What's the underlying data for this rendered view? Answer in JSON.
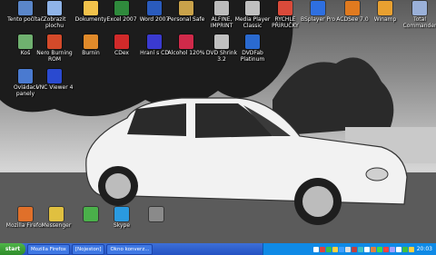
{
  "desktop_icons": [
    {
      "name": "tento-pocitac",
      "label": "Tento počítač",
      "color": "#5a86c9"
    },
    {
      "name": "zobrazit-plochu",
      "label": "Zobrazit plochu",
      "color": "#8fb4e8"
    },
    {
      "name": "dokumenty",
      "label": "Dokumenty",
      "color": "#f2c24b"
    },
    {
      "name": "excel-2007",
      "label": "Excel 2007",
      "color": "#2f8a3c"
    },
    {
      "name": "word-2007",
      "label": "Word 2007",
      "color": "#2a5bbd"
    },
    {
      "name": "personal-safe",
      "label": "Personal Safe",
      "color": "#c9a24a"
    },
    {
      "name": "alfine-imprint",
      "label": "ALFINE, IMPRINT",
      "color": "#bcbcbc"
    },
    {
      "name": "media-player-classic",
      "label": "Media Player Classic",
      "color": "#bfbfbf"
    },
    {
      "name": "rychle-prirucky",
      "label": "RYCHLE PŘÍRUČKY",
      "color": "#d94a3a"
    },
    {
      "name": "bsplayer-pro",
      "label": "BSplayer Pro",
      "color": "#2e6fe0"
    },
    {
      "name": "acdsee",
      "label": "ACDSee 7.0",
      "color": "#e07a1f"
    },
    {
      "name": "winamp",
      "label": "Winamp",
      "color": "#e8a030"
    },
    {
      "name": "total-commander",
      "label": "Total Commander",
      "color": "#9ab0d8"
    },
    {
      "name": "kos",
      "label": "Koš",
      "color": "#6fb06f"
    },
    {
      "name": "nero-burning-rom",
      "label": "Nero Burning ROM",
      "color": "#d44a2a"
    },
    {
      "name": "burnin",
      "label": "Burnin",
      "color": "#e08a2a"
    },
    {
      "name": "cdex",
      "label": "CDex",
      "color": "#d02a2a"
    },
    {
      "name": "hrani-s-cd",
      "label": "Hraní s CD",
      "color": "#3a3ad0"
    },
    {
      "name": "alcohol-120",
      "label": "Alcohol 120%",
      "color": "#d02a4a"
    },
    {
      "name": "dvd-shrink",
      "label": "DVD Shrink 3.2",
      "color": "#c0c0c0"
    },
    {
      "name": "dvdfab-platinum",
      "label": "DVDFab Platinum",
      "color": "#2a6ad0"
    },
    {
      "name": "ovladaci-panely",
      "label": "Ovládací panely",
      "color": "#4a7ad0"
    },
    {
      "name": "vnc-viewer",
      "label": "VNC Viewer 4",
      "color": "#2a4ad0"
    }
  ],
  "bottom_icons": [
    {
      "name": "mozilla-firefox",
      "label": "Mozilla Firefox",
      "color": "#e0702a"
    },
    {
      "name": "messenger",
      "label": "Messenger",
      "color": "#e0c040"
    },
    {
      "name": "net-icon",
      "label": "",
      "color": "#4ab04a"
    },
    {
      "name": "skype",
      "label": "Skype",
      "color": "#2a9ae0"
    },
    {
      "name": "app-icon-2",
      "label": "",
      "color": "#8a8a8a"
    }
  ],
  "taskbar": {
    "start_label": "start",
    "tasks": [
      {
        "name": "task-mozilla-firefox",
        "label": "Mozilla Firefox"
      },
      {
        "name": "task-nojeston",
        "label": "[Nojeston]"
      },
      {
        "name": "task-okno-konverzace",
        "label": "Okno konverz..."
      }
    ],
    "clock": "20:03"
  },
  "tray_icons": [
    {
      "name": "tray-icon-1",
      "color": "#ffffff"
    },
    {
      "name": "tray-icon-2",
      "color": "#e04040"
    },
    {
      "name": "tray-icon-3",
      "color": "#40c040"
    },
    {
      "name": "tray-icon-4",
      "color": "#ffd040"
    },
    {
      "name": "tray-icon-5",
      "color": "#40a0ff"
    },
    {
      "name": "tray-icon-6",
      "color": "#e0e0e0"
    },
    {
      "name": "tray-icon-7",
      "color": "#c04040"
    },
    {
      "name": "tray-icon-8",
      "color": "#40c0c0"
    },
    {
      "name": "tray-icon-9",
      "color": "#ffffff"
    },
    {
      "name": "tray-icon-10",
      "color": "#e08040"
    },
    {
      "name": "tray-icon-11",
      "color": "#40e040"
    },
    {
      "name": "tray-icon-12",
      "color": "#ff4040"
    },
    {
      "name": "tray-icon-13",
      "color": "#a0a0ff"
    },
    {
      "name": "tray-icon-14",
      "color": "#ffffff"
    },
    {
      "name": "tray-icon-15",
      "color": "#40c040"
    },
    {
      "name": "tray-icon-16",
      "color": "#ffd040"
    }
  ]
}
